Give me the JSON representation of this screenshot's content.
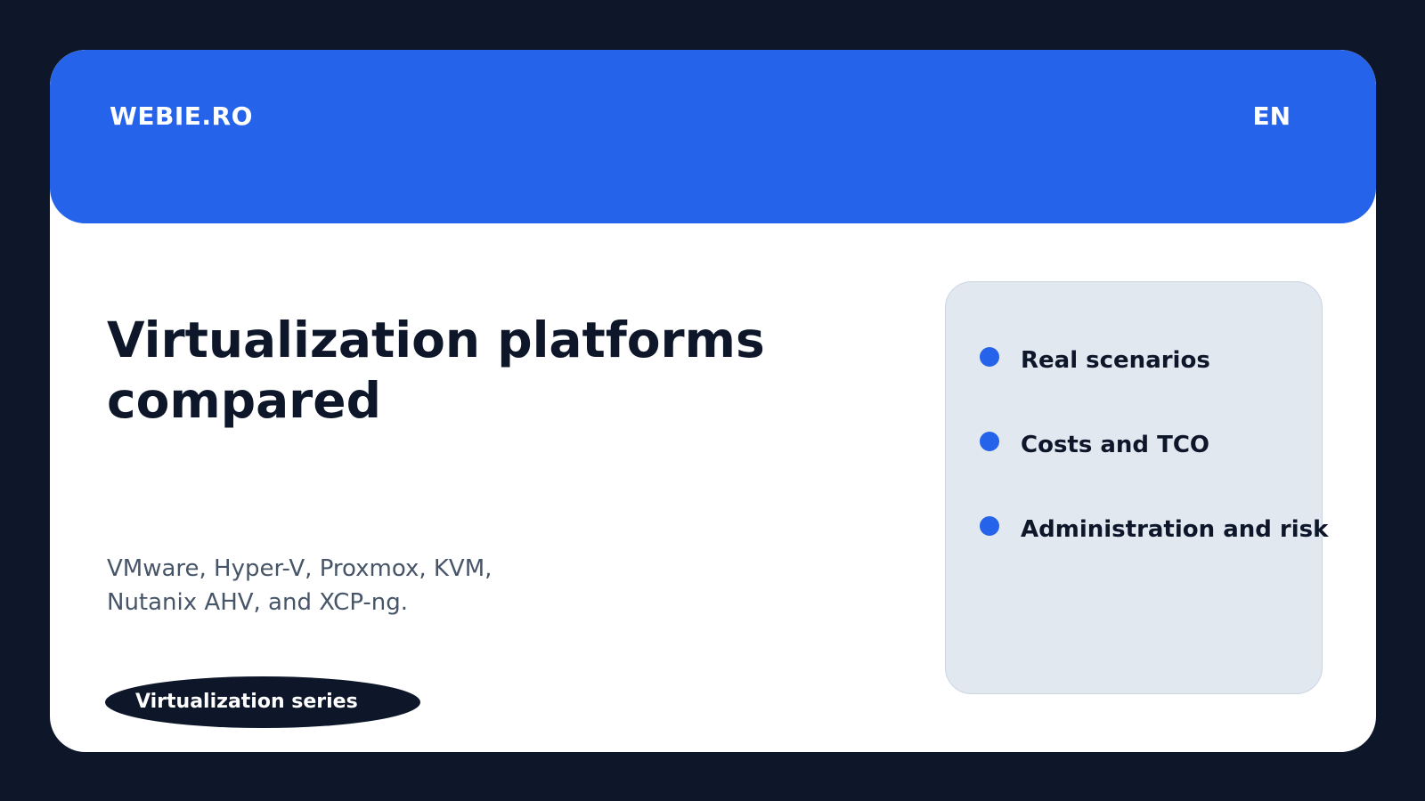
{
  "header": {
    "brand": "WEBIE.RO",
    "language": "EN"
  },
  "main": {
    "title": "Virtualization platforms compared",
    "subtitle": "VMware, Hyper-V, Proxmox, KVM, Nutanix AHV, and XCP-ng.",
    "series_label": "Virtualization series"
  },
  "panel": {
    "items": [
      {
        "label": "Real scenarios",
        "icon": "bullet-dot-icon"
      },
      {
        "label": "Costs and TCO",
        "icon": "bullet-dot-icon"
      },
      {
        "label": "Administration and risk",
        "icon": "bullet-dot-icon"
      }
    ]
  },
  "colors": {
    "accent": "#2563eb",
    "background": "#0e172a",
    "panel": "#e2e8f0",
    "card": "#ffffff",
    "muted_text": "#475569"
  }
}
